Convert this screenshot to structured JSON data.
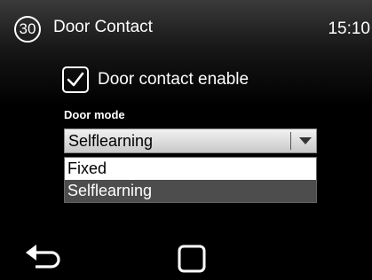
{
  "header": {
    "screen_number": "30",
    "title": "Door Contact",
    "time": "15:10"
  },
  "door_contact": {
    "enable_label": "Door contact enable",
    "enabled": true
  },
  "door_mode": {
    "label": "Door mode",
    "selected": "Selflearning",
    "options": [
      {
        "label": "Fixed",
        "selected": false
      },
      {
        "label": "Selflearning",
        "selected": true
      }
    ]
  },
  "nav": {
    "back_icon": "back-arrow-icon",
    "home_icon": "home-square-icon"
  }
}
